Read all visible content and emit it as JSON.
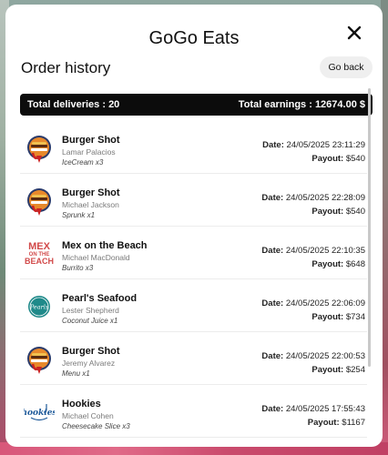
{
  "app": {
    "title": "GoGo Eats"
  },
  "header": {
    "page_title": "Order history",
    "back_label": "Go back"
  },
  "summary": {
    "deliveries_label": "Total deliveries : ",
    "deliveries_value": "20",
    "earnings_label": "Total earnings : ",
    "earnings_value": "12674.00 $"
  },
  "labels": {
    "date": "Date:",
    "payout": "Payout:"
  },
  "orders": [
    {
      "restaurant": "Burger Shot",
      "logo": "burger-shot-logo",
      "customer": "Lamar Palacios",
      "items": "IceCream x3",
      "date": "24/05/2025 23:11:29",
      "payout": "$540"
    },
    {
      "restaurant": "Burger Shot",
      "logo": "burger-shot-logo",
      "customer": "Michael Jackson",
      "items": "Sprunk x1",
      "date": "24/05/2025 22:28:09",
      "payout": "$540"
    },
    {
      "restaurant": "Mex on the Beach",
      "logo": "mex-on-the-beach-logo",
      "customer": "Michael MacDonald",
      "items": "Burrito x3",
      "date": "24/05/2025 22:10:35",
      "payout": "$648"
    },
    {
      "restaurant": "Pearl's Seafood",
      "logo": "pearls-seafood-logo",
      "customer": "Lester Shepherd",
      "items": "Coconut Juice x1",
      "date": "24/05/2025 22:06:09",
      "payout": "$734"
    },
    {
      "restaurant": "Burger Shot",
      "logo": "burger-shot-logo",
      "customer": "Jeremy Alvarez",
      "items": "Menu x1",
      "date": "24/05/2025 22:00:53",
      "payout": "$254"
    },
    {
      "restaurant": "Hookies",
      "logo": "hookies-logo",
      "customer": "Michael Cohen",
      "items": "Cheesecake Slice x3",
      "date": "24/05/2025 17:55:43",
      "payout": "$1167"
    }
  ],
  "logos": {
    "mex_line1": "MEX",
    "mex_line2": "ON THE",
    "mex_line3": "BEACH",
    "pearls_text": "Pearls",
    "hookies_text": "hookies"
  },
  "colors": {
    "summary_bg": "#0c0c0c",
    "panel_bg": "#ffffff",
    "back_btn_bg": "#efefef"
  }
}
